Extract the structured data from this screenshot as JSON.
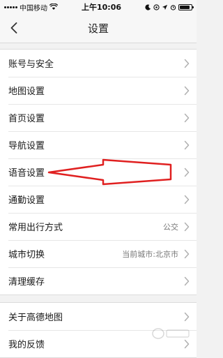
{
  "status_bar": {
    "carrier": "中国移动",
    "wifi_icon": "wifi-icon",
    "time": "上午10:06",
    "icons": [
      "moon-icon",
      "at-icon",
      "location-icon",
      "alarm-icon"
    ],
    "battery_level": 0.85
  },
  "nav": {
    "back_icon": "chevron-left-icon",
    "title": "设置"
  },
  "sections": [
    {
      "rows": [
        {
          "label": "账号与安全",
          "value": ""
        },
        {
          "label": "地图设置",
          "value": ""
        },
        {
          "label": "首页设置",
          "value": ""
        },
        {
          "label": "导航设置",
          "value": ""
        },
        {
          "label": "语音设置",
          "value": ""
        },
        {
          "label": "通勤设置",
          "value": ""
        },
        {
          "label": "常用出行方式",
          "value": "公交"
        },
        {
          "label": "城市切换",
          "value": "当前城市:北京市"
        },
        {
          "label": "清理缓存",
          "value": ""
        }
      ]
    },
    {
      "rows": [
        {
          "label": "关于高德地图",
          "value": ""
        },
        {
          "label": "我的反馈",
          "value": ""
        }
      ]
    }
  ],
  "annotation": {
    "arrow_color": "#e02020",
    "points_to": "语音设置"
  },
  "colors": {
    "background": "#f2f2f2",
    "row_background": "#ffffff",
    "chevron": "#b0b0b0"
  }
}
